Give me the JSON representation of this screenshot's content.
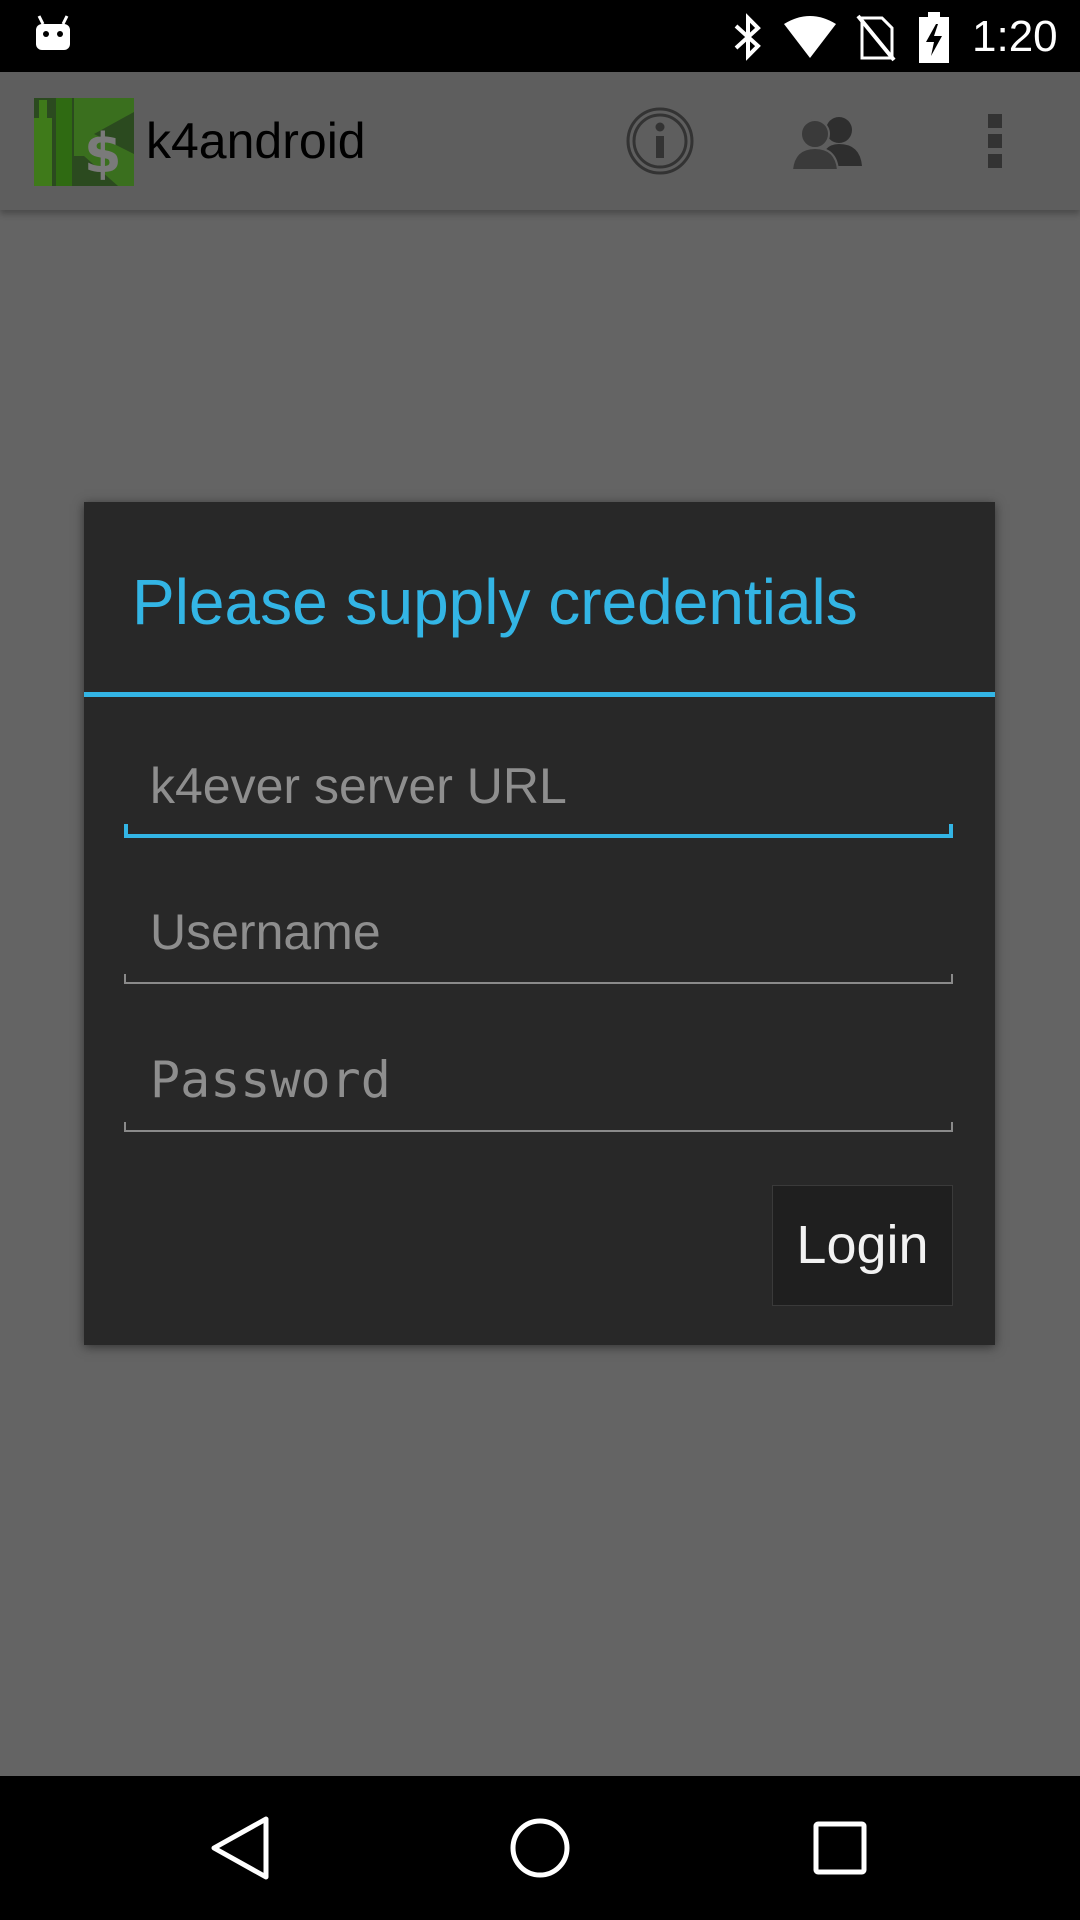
{
  "status_bar": {
    "time": "1:20",
    "icons": [
      "android-notification-icon",
      "bluetooth-icon",
      "wifi-icon",
      "no-sim-icon",
      "battery-charging-icon"
    ]
  },
  "action_bar": {
    "title": "k4android",
    "actions": [
      "info-icon",
      "users-icon",
      "overflow-menu-icon"
    ]
  },
  "dialog": {
    "title": "Please supply credentials",
    "fields": {
      "server_url": {
        "value": "",
        "placeholder": "k4ever server URL"
      },
      "username": {
        "value": "",
        "placeholder": "Username"
      },
      "password": {
        "value": "",
        "placeholder": "Password"
      }
    },
    "login_label": "Login"
  },
  "nav_bar": {
    "buttons": [
      "back-icon",
      "home-icon",
      "recents-icon"
    ]
  },
  "colors": {
    "accent": "#33b5e5",
    "dialog_bg": "#282828",
    "scrim_bg": "#646464"
  }
}
